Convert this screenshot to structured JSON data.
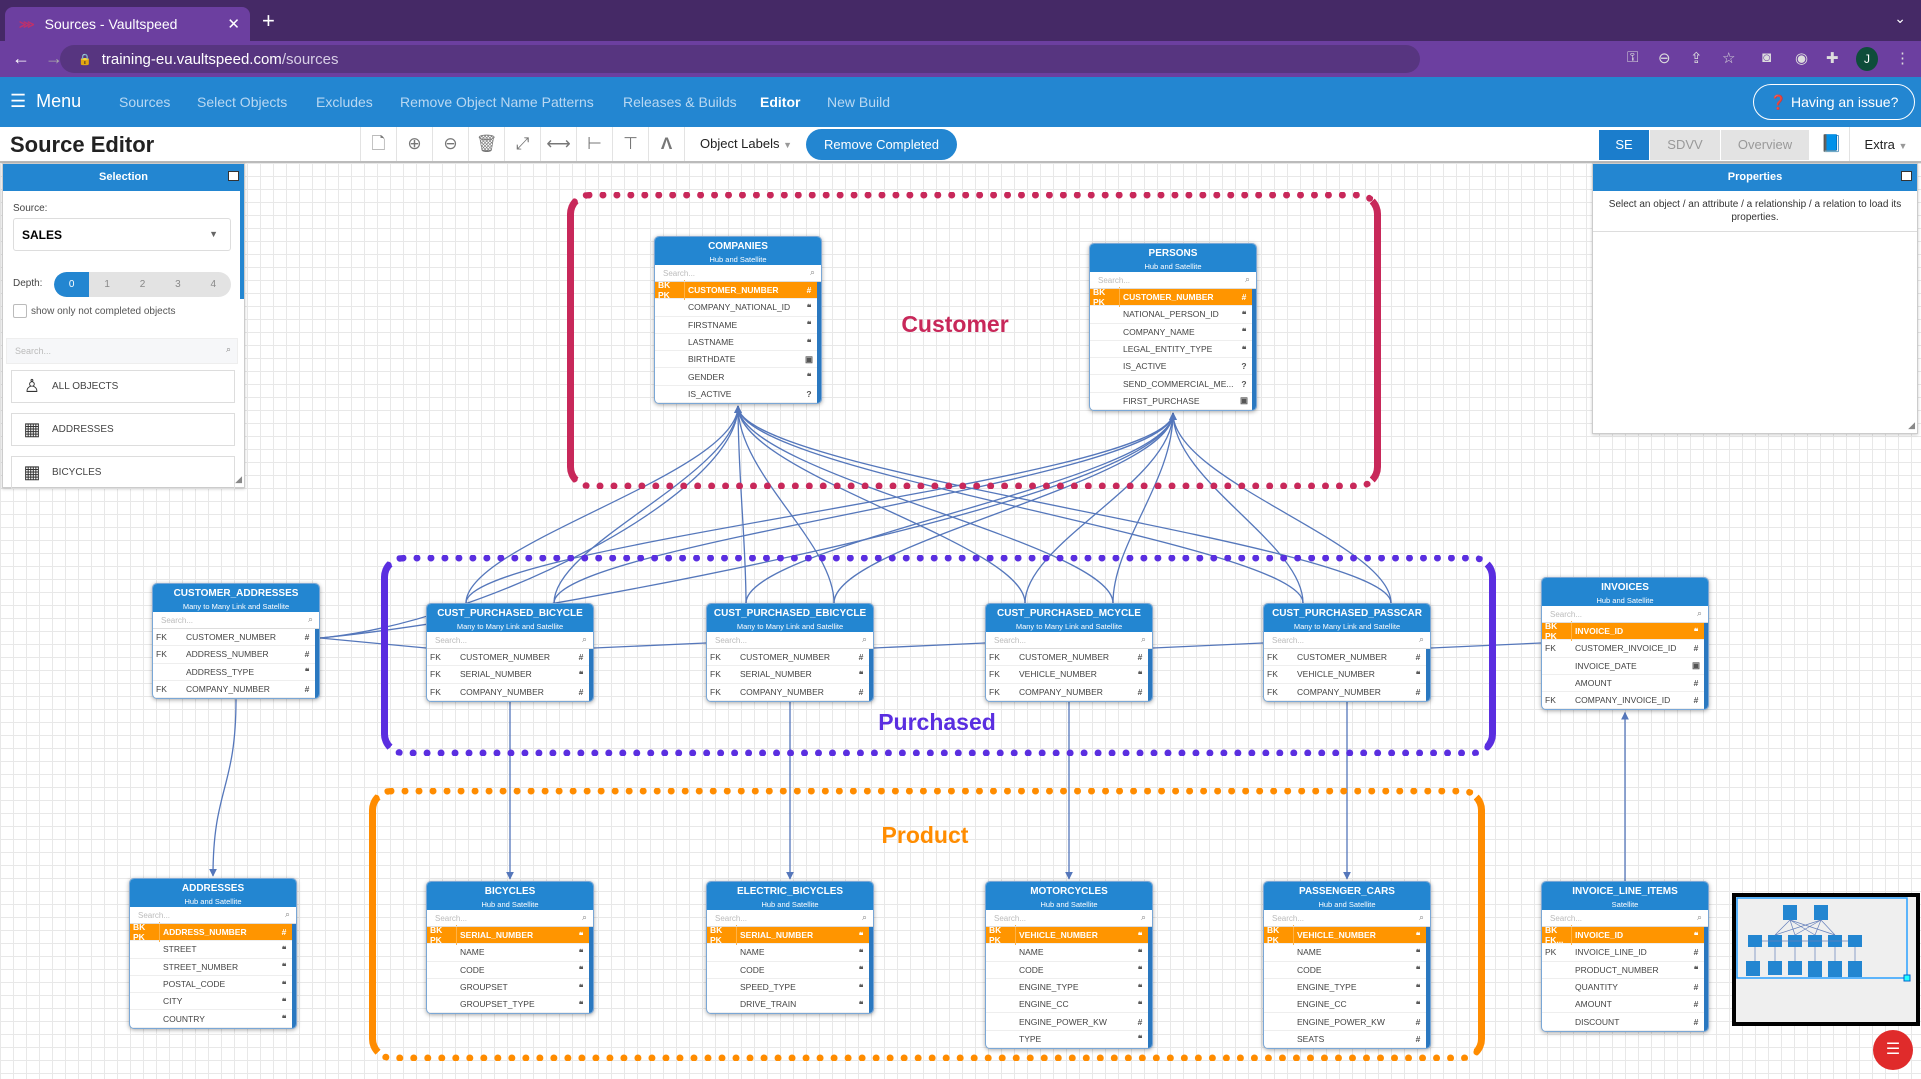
{
  "browser": {
    "tab_title": "Sources - Vaultspeed",
    "url_host": "training-eu.vaultspeed.com",
    "url_path": "/sources",
    "avatar_letter": "J"
  },
  "nav": {
    "menu_label": "Menu",
    "items": [
      "Sources",
      "Select Objects",
      "Excludes",
      "Remove Object Name Patterns",
      "Releases & Builds",
      "Editor",
      "New Build"
    ],
    "active": "Editor",
    "issue_label": "Having an issue?"
  },
  "toolbar": {
    "title": "Source Editor",
    "object_labels": "Object Labels",
    "remove_completed": "Remove Completed",
    "views": [
      "SE",
      "SDVV",
      "Overview"
    ],
    "active_view": "SE",
    "extra": "Extra"
  },
  "selection": {
    "title": "Selection",
    "source_label": "Source:",
    "source_value": "SALES",
    "depth_label": "Depth:",
    "depth_options": [
      "0",
      "1",
      "2",
      "3",
      "4"
    ],
    "depth_selected": "0",
    "checkbox_label": "show only not completed objects",
    "checkbox_checked": false,
    "search_placeholder": "Search...",
    "items": [
      "ALL OBJECTS",
      "ADDRESSES",
      "BICYCLES"
    ]
  },
  "properties": {
    "title": "Properties",
    "message": "Select an object / an attribute / a relationship / a relation to load its properties."
  },
  "groups": [
    {
      "label": "Customer",
      "color": "#c8285a"
    },
    {
      "label": "Purchased",
      "color": "#5a2ee0"
    },
    {
      "label": "Product",
      "color": "#ff8c00"
    }
  ],
  "search_placeholder": "Search...",
  "tables": [
    {
      "name": "COMPANIES",
      "type": "Hub and Satellite",
      "rows": [
        [
          "BK PK",
          "CUSTOMER_NUMBER",
          "number"
        ],
        [
          "",
          "COMPANY_NATIONAL_ID",
          "string"
        ],
        [
          "",
          "FIRSTNAME",
          "string"
        ],
        [
          "",
          "LASTNAME",
          "string"
        ],
        [
          "",
          "BIRTHDATE",
          "date"
        ],
        [
          "",
          "GENDER",
          "string"
        ],
        [
          "",
          "IS_ACTIVE",
          "boolean"
        ]
      ]
    },
    {
      "name": "PERSONS",
      "type": "Hub and Satellite",
      "rows": [
        [
          "BK PK",
          "CUSTOMER_NUMBER",
          "number"
        ],
        [
          "",
          "NATIONAL_PERSON_ID",
          "string"
        ],
        [
          "",
          "COMPANY_NAME",
          "string"
        ],
        [
          "",
          "LEGAL_ENTITY_TYPE",
          "string"
        ],
        [
          "",
          "IS_ACTIVE",
          "boolean"
        ],
        [
          "",
          "SEND_COMMERCIAL_ME...",
          "boolean"
        ],
        [
          "",
          "FIRST_PURCHASE",
          "date"
        ]
      ]
    },
    {
      "name": "CUSTOMER_ADDRESSES",
      "type": "Many to Many Link and Satellite",
      "rows": [
        [
          "FK",
          "CUSTOMER_NUMBER",
          "number"
        ],
        [
          "FK",
          "ADDRESS_NUMBER",
          "number"
        ],
        [
          "",
          "ADDRESS_TYPE",
          "string"
        ],
        [
          "FK",
          "COMPANY_NUMBER",
          "number"
        ]
      ]
    },
    {
      "name": "CUST_PURCHASED_BICYCLE",
      "type": "Many to Many Link and Satellite",
      "rows": [
        [
          "FK",
          "CUSTOMER_NUMBER",
          "number"
        ],
        [
          "FK",
          "SERIAL_NUMBER",
          "string"
        ],
        [
          "FK",
          "COMPANY_NUMBER",
          "number"
        ]
      ]
    },
    {
      "name": "CUST_PURCHASED_EBICYCLE",
      "type": "Many to Many Link and Satellite",
      "rows": [
        [
          "FK",
          "CUSTOMER_NUMBER",
          "number"
        ],
        [
          "FK",
          "SERIAL_NUMBER",
          "string"
        ],
        [
          "FK",
          "COMPANY_NUMBER",
          "number"
        ]
      ]
    },
    {
      "name": "CUST_PURCHASED_MCYCLE",
      "type": "Many to Many Link and Satellite",
      "rows": [
        [
          "FK",
          "CUSTOMER_NUMBER",
          "number"
        ],
        [
          "FK",
          "VEHICLE_NUMBER",
          "string"
        ],
        [
          "FK",
          "COMPANY_NUMBER",
          "number"
        ]
      ]
    },
    {
      "name": "CUST_PURCHASED_PASSCAR",
      "type": "Many to Many Link and Satellite",
      "rows": [
        [
          "FK",
          "CUSTOMER_NUMBER",
          "number"
        ],
        [
          "FK",
          "VEHICLE_NUMBER",
          "string"
        ],
        [
          "FK",
          "COMPANY_NUMBER",
          "number"
        ]
      ]
    },
    {
      "name": "INVOICES",
      "type": "Hub and Satellite",
      "rows": [
        [
          "BK PK",
          "INVOICE_ID",
          "string"
        ],
        [
          "FK",
          "CUSTOMER_INVOICE_ID",
          "number"
        ],
        [
          "",
          "INVOICE_DATE",
          "date"
        ],
        [
          "",
          "AMOUNT",
          "number"
        ],
        [
          "FK",
          "COMPANY_INVOICE_ID",
          "number"
        ]
      ]
    },
    {
      "name": "ADDRESSES",
      "type": "Hub and Satellite",
      "rows": [
        [
          "BK PK",
          "ADDRESS_NUMBER",
          "number"
        ],
        [
          "",
          "STREET",
          "string"
        ],
        [
          "",
          "STREET_NUMBER",
          "string"
        ],
        [
          "",
          "POSTAL_CODE",
          "string"
        ],
        [
          "",
          "CITY",
          "string"
        ],
        [
          "",
          "COUNTRY",
          "string"
        ]
      ]
    },
    {
      "name": "BICYCLES",
      "type": "Hub and Satellite",
      "rows": [
        [
          "BK PK",
          "SERIAL_NUMBER",
          "string"
        ],
        [
          "",
          "NAME",
          "string"
        ],
        [
          "",
          "CODE",
          "string"
        ],
        [
          "",
          "GROUPSET",
          "string"
        ],
        [
          "",
          "GROUPSET_TYPE",
          "string"
        ]
      ]
    },
    {
      "name": "ELECTRIC_BICYCLES",
      "type": "Hub and Satellite",
      "rows": [
        [
          "BK PK",
          "SERIAL_NUMBER",
          "string"
        ],
        [
          "",
          "NAME",
          "string"
        ],
        [
          "",
          "CODE",
          "string"
        ],
        [
          "",
          "SPEED_TYPE",
          "string"
        ],
        [
          "",
          "DRIVE_TRAIN",
          "string"
        ]
      ]
    },
    {
      "name": "MOTORCYCLES",
      "type": "Hub and Satellite",
      "rows": [
        [
          "BK PK",
          "VEHICLE_NUMBER",
          "string"
        ],
        [
          "",
          "NAME",
          "string"
        ],
        [
          "",
          "CODE",
          "string"
        ],
        [
          "",
          "ENGINE_TYPE",
          "string"
        ],
        [
          "",
          "ENGINE_CC",
          "string"
        ],
        [
          "",
          "ENGINE_POWER_KW",
          "number"
        ],
        [
          "",
          "TYPE",
          "string"
        ]
      ]
    },
    {
      "name": "PASSENGER_CARS",
      "type": "Hub and Satellite",
      "rows": [
        [
          "BK PK",
          "VEHICLE_NUMBER",
          "string"
        ],
        [
          "",
          "NAME",
          "string"
        ],
        [
          "",
          "CODE",
          "string"
        ],
        [
          "",
          "ENGINE_TYPE",
          "string"
        ],
        [
          "",
          "ENGINE_CC",
          "string"
        ],
        [
          "",
          "ENGINE_POWER_KW",
          "number"
        ],
        [
          "",
          "SEATS",
          "number"
        ]
      ]
    },
    {
      "name": "INVOICE_LINE_ITEMS",
      "type": "Satellite",
      "rows": [
        [
          "BK FK...",
          "INVOICE_ID",
          "string"
        ],
        [
          "PK",
          "INVOICE_LINE_ID",
          "number"
        ],
        [
          "",
          "PRODUCT_NUMBER",
          "string"
        ],
        [
          "",
          "QUANTITY",
          "number"
        ],
        [
          "",
          "AMOUNT",
          "number"
        ],
        [
          "",
          "DISCOUNT",
          "number"
        ]
      ]
    }
  ],
  "colors": {
    "accent": "#2386d1",
    "pk_row": "#ff9500",
    "fab": "#e02b2b",
    "edge": "#5577bb"
  }
}
